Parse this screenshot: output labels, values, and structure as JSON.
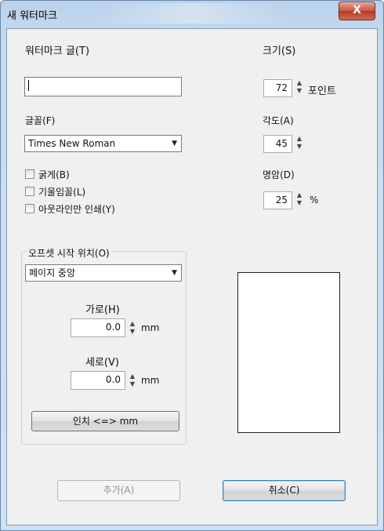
{
  "window": {
    "title": "새 워터마크",
    "close_label": "X"
  },
  "text_field": {
    "label": "워터마크 글(T)",
    "value": ""
  },
  "size": {
    "label": "크기(S)",
    "value": "72",
    "unit": "포인트"
  },
  "font": {
    "label": "글꼴(F)",
    "value": "Times New Roman"
  },
  "angle": {
    "label": "각도(A)",
    "value": "45"
  },
  "brightness": {
    "label": "명암(D)",
    "value": "25",
    "unit": "%"
  },
  "checkboxes": {
    "bold": "굵게(B)",
    "italic": "기울임꼴(L)",
    "outline": "아웃라인만 인쇄(Y)"
  },
  "offset": {
    "group_title": "오프셋 시작 위치(O)",
    "position_value": "페이지 중앙",
    "horizontal_label": "가로(H)",
    "horizontal_value": "0.0",
    "vertical_label": "세로(V)",
    "vertical_value": "0.0",
    "unit": "mm",
    "unit_toggle_label": "인치 <=> mm"
  },
  "buttons": {
    "add": "추가(A)",
    "cancel": "취소(C)"
  }
}
